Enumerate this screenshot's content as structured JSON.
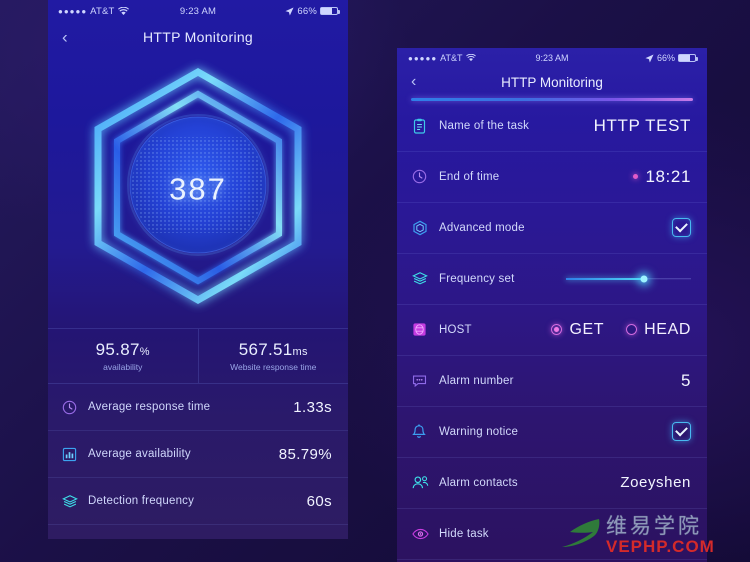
{
  "left_phone": {
    "status_bar": {
      "carrier": "AT&T",
      "signal_dots": "●●●●●",
      "wifi_icon": "wifi-icon",
      "time": "9:23 AM",
      "location_icon": "location-arrow-icon",
      "battery_percent": "66%",
      "battery_icon": "battery-icon"
    },
    "nav": {
      "back_icon": "chevron-left-icon",
      "title": "HTTP Monitoring"
    },
    "gauge": {
      "value": "387",
      "shape": "hexagon-ring"
    },
    "stats": [
      {
        "value": "95.87",
        "unit": "%",
        "label": "availability"
      },
      {
        "value": "567.51",
        "unit": "ms",
        "label": "Website response time"
      }
    ],
    "rows": [
      {
        "icon": "clock-icon",
        "label": "Average response time",
        "value": "1.33s"
      },
      {
        "icon": "chart-grid-icon",
        "label": "Average availability",
        "value": "85.79%"
      },
      {
        "icon": "layers-icon",
        "label": "Detection frequency",
        "value": "60s"
      }
    ]
  },
  "right_phone": {
    "status_bar": {
      "carrier": "AT&T",
      "signal_dots": "●●●●●",
      "wifi_icon": "wifi-icon",
      "time": "9:23 AM",
      "location_icon": "location-arrow-icon",
      "battery_percent": "66%",
      "battery_icon": "battery-icon"
    },
    "nav": {
      "back_icon": "chevron-left-icon",
      "title": "HTTP Monitoring"
    },
    "rows": {
      "task_name": {
        "icon": "clipboard-icon",
        "label": "Name of the task",
        "value": "HTTP TEST"
      },
      "end_of_time": {
        "icon": "clock-icon",
        "label": "End of time",
        "value": "18:21"
      },
      "advanced_mode": {
        "icon": "shield-hex-icon",
        "label": "Advanced mode",
        "checked": true
      },
      "frequency_set": {
        "icon": "layers-icon",
        "label": "Frequency set",
        "position_percent": 62
      },
      "host": {
        "icon": "host-icon",
        "label": "HOST",
        "methods": [
          {
            "label": "GET",
            "selected": true
          },
          {
            "label": "HEAD",
            "selected": false
          }
        ]
      },
      "alarm_number": {
        "icon": "chat-bubble-icon",
        "label": "Alarm number",
        "value": "5"
      },
      "warning_notice": {
        "icon": "bell-icon",
        "label": "Warning notice",
        "checked": true
      },
      "alarm_contacts": {
        "icon": "contacts-icon",
        "label": "Alarm contacts",
        "value": "Zoeyshen"
      },
      "hide_task": {
        "icon": "eye-icon",
        "label": "Hide task",
        "value": ""
      }
    }
  },
  "watermark": {
    "logo_icon": "bird-logo-icon",
    "cn_text": "维易学院",
    "en_text": "VEPHP.COM"
  },
  "colors": {
    "accent_cyan": "#4fd8f5",
    "accent_blue": "#2f7fe8",
    "accent_magenta": "#e25cc9",
    "bg_deep": "#120a33"
  }
}
